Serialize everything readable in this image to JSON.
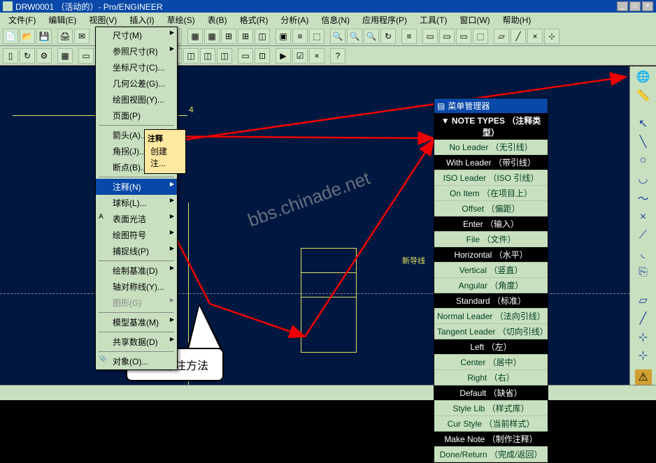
{
  "window": {
    "title": "DRW0001 （活动的）- Pro/ENGINEER",
    "min": "_",
    "max": "□",
    "close": "×"
  },
  "menubar": [
    "文件(F)",
    "编辑(E)",
    "视图(V)",
    "插入(I)",
    "草绘(S)",
    "表(B)",
    "格式(R)",
    "分析(A)",
    "信息(N)",
    "应用程序(P)",
    "工具(T)",
    "窗口(W)",
    "帮助(H)"
  ],
  "dropdown": {
    "items": [
      {
        "label": "尺寸(M)",
        "sub": true
      },
      {
        "label": "参照尺寸(R)",
        "sub": true
      },
      {
        "label": "坐标尺寸(C)..."
      },
      {
        "label": "几何公差(G)..."
      },
      {
        "label": "绘图视图(Y)..."
      },
      {
        "label": "页面(P)"
      },
      {
        "sep": true
      },
      {
        "label": "箭头(A)..."
      },
      {
        "label": "角拐(J)..."
      },
      {
        "label": "断点(B)..."
      },
      {
        "sep": true
      },
      {
        "label": "注释(N)",
        "highlighted": true,
        "sub": true
      },
      {
        "label": "球标(L)...",
        "sub": true
      },
      {
        "label": "表面光洁",
        "sub": true
      },
      {
        "label": "绘图符号",
        "sub": true
      },
      {
        "label": "捕捉线(P)",
        "sub": true
      },
      {
        "sep": true
      },
      {
        "label": "绘制基准(D)",
        "sub": true
      },
      {
        "label": "轴对称线(Y)..."
      },
      {
        "label": "图形(G)",
        "sub": true,
        "disabled": true
      },
      {
        "sep": true
      },
      {
        "label": "模型基准(M)",
        "sub": true
      },
      {
        "sep": true
      },
      {
        "label": "共享数据(D)",
        "sub": true
      },
      {
        "sep": true
      },
      {
        "label": "对象(O)...",
        "icon": "📎"
      }
    ]
  },
  "submenu": {
    "title": "注释",
    "item": "创建注..."
  },
  "notePanel": {
    "header": "菜单管理器",
    "sections": [
      {
        "title": "▼ NOTE TYPES （注释类型）",
        "items": [
          {
            "label": "No Leader （无引线）"
          },
          {
            "label": "With Leader （带引线）",
            "selected": true
          },
          {
            "label": "ISO Leader （ISO 引线）"
          },
          {
            "label": "On Item （在项目上）"
          },
          {
            "label": "Offset （偏距）"
          }
        ]
      },
      {
        "title": "Enter （输入）",
        "items": [
          {
            "label": "File （文件）"
          }
        ],
        "std": true
      },
      {
        "title": "Horizontal （水平）",
        "items": [
          {
            "label": "Vertical （竖直）"
          },
          {
            "label": "Angular （角度）"
          }
        ],
        "std": true
      },
      {
        "title": "Standard （标准）",
        "items": [
          {
            "label": "Normal Leader （法向引线）"
          },
          {
            "label": "Tangent Leader （切向引线）"
          }
        ],
        "std": true
      },
      {
        "title": "Left （左）",
        "items": [
          {
            "label": "Center （居中）"
          },
          {
            "label": "Right （右）"
          }
        ],
        "std": true
      },
      {
        "title": "Default （缺省）",
        "items": [
          {
            "label": "Style Lib （样式库）"
          },
          {
            "label": "Cur Style （当前样式）"
          }
        ],
        "std": true
      },
      {
        "title": "Make Note （制作注释）",
        "items": [
          {
            "label": "Done/Return （完成/返回）"
          }
        ],
        "std": true
      }
    ]
  },
  "callout": "虚线标注方法",
  "annotation": "新导线",
  "watermark": "bbs.chinade.net",
  "dimension": "4"
}
